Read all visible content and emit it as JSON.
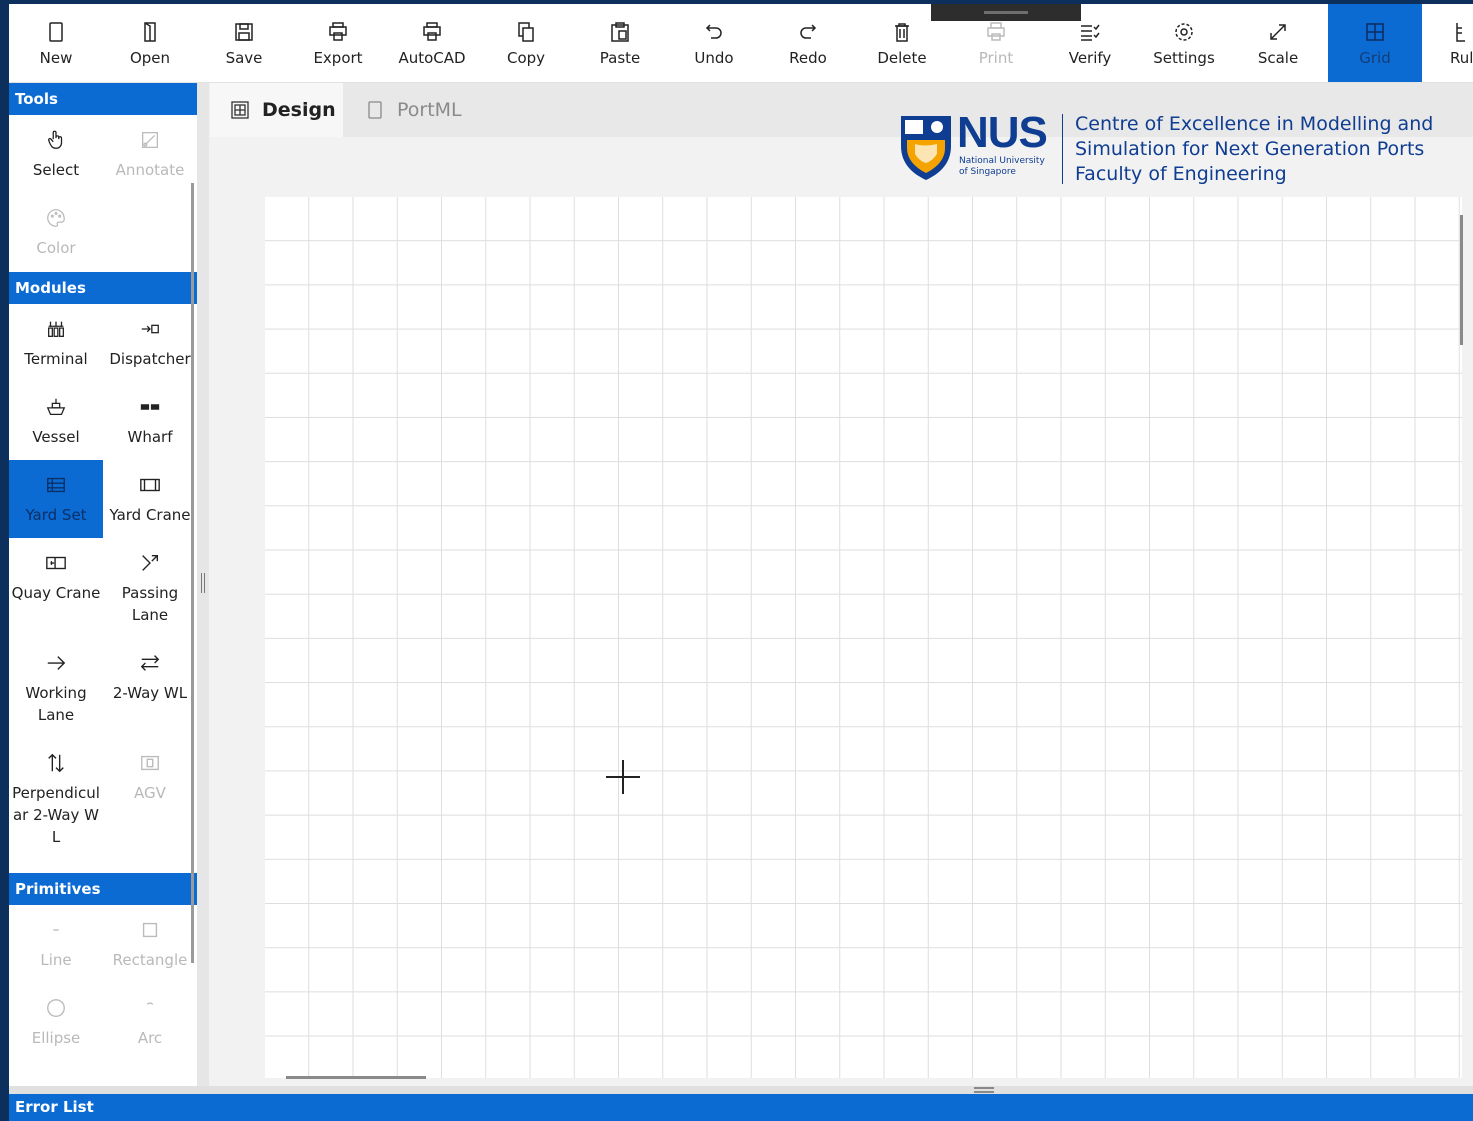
{
  "toolbar": {
    "buttons": [
      {
        "label": "New",
        "icon": "new-document-icon"
      },
      {
        "label": "Open",
        "icon": "open-icon"
      },
      {
        "label": "Save",
        "icon": "save-icon"
      },
      {
        "label": "Export",
        "icon": "export-icon"
      },
      {
        "label": "AutoCAD",
        "icon": "autocad-icon"
      },
      {
        "label": "Copy",
        "icon": "copy-icon"
      },
      {
        "label": "Paste",
        "icon": "paste-icon"
      },
      {
        "label": "Undo",
        "icon": "undo-icon"
      },
      {
        "label": "Redo",
        "icon": "redo-icon"
      },
      {
        "label": "Delete",
        "icon": "delete-icon"
      },
      {
        "label": "Print",
        "icon": "print-icon"
      },
      {
        "label": "Verify",
        "icon": "verify-icon"
      },
      {
        "label": "Settings",
        "icon": "gear-icon"
      },
      {
        "label": "Scale",
        "icon": "scale-icon"
      },
      {
        "label": "Grid",
        "icon": "grid-icon"
      },
      {
        "label": "Rul",
        "icon": "ruler-icon"
      }
    ]
  },
  "sidebar": {
    "tools_header": "Tools",
    "tools": [
      {
        "label": "Select",
        "icon": "select-hand-icon"
      },
      {
        "label": "Annotate",
        "icon": "annotate-icon"
      },
      {
        "label": "Color",
        "icon": "palette-icon"
      }
    ],
    "modules_header": "Modules",
    "modules": [
      {
        "label": "Terminal",
        "icon": "terminal-icon"
      },
      {
        "label": "Dispatcher",
        "icon": "dispatcher-icon"
      },
      {
        "label": "Vessel",
        "icon": "vessel-icon"
      },
      {
        "label": "Wharf",
        "icon": "wharf-icon"
      },
      {
        "label": "Yard Set",
        "icon": "yard-set-icon"
      },
      {
        "label": "Yard Crane",
        "icon": "yard-crane-icon"
      },
      {
        "label": "Quay Crane",
        "icon": "quay-crane-icon"
      },
      {
        "label": "Passing Lane",
        "icon": "passing-lane-icon"
      },
      {
        "label": "Working Lane",
        "icon": "arrow-right-icon"
      },
      {
        "label": "2-Way WL",
        "icon": "two-way-arrow-icon"
      },
      {
        "label": "Perpendicular 2-Way WL",
        "icon": "up-down-arrow-icon"
      },
      {
        "label": "AGV",
        "icon": "agv-icon"
      }
    ],
    "primitives_header": "Primitives",
    "primitives": [
      {
        "label": "Line",
        "icon": "line-icon"
      },
      {
        "label": "Rectangle",
        "icon": "rectangle-icon"
      },
      {
        "label": "Ellipse",
        "icon": "ellipse-icon"
      },
      {
        "label": "Arc",
        "icon": "arc-icon"
      }
    ]
  },
  "tabs": {
    "design": "Design",
    "portml": "PortML"
  },
  "logo": {
    "nus": "NUS",
    "nus_sub_1": "National University",
    "nus_sub_2": "of Singapore",
    "org_line_1": "Centre of Excellence in Modelling and",
    "org_line_2": "Simulation for Next Generation Ports",
    "org_line_3": "Faculty of Engineering"
  },
  "status": {
    "error_list": "Error List"
  },
  "colors": {
    "accent": "#0b6bd3",
    "frame": "#0d2f5c",
    "brand": "#0f3d91"
  }
}
